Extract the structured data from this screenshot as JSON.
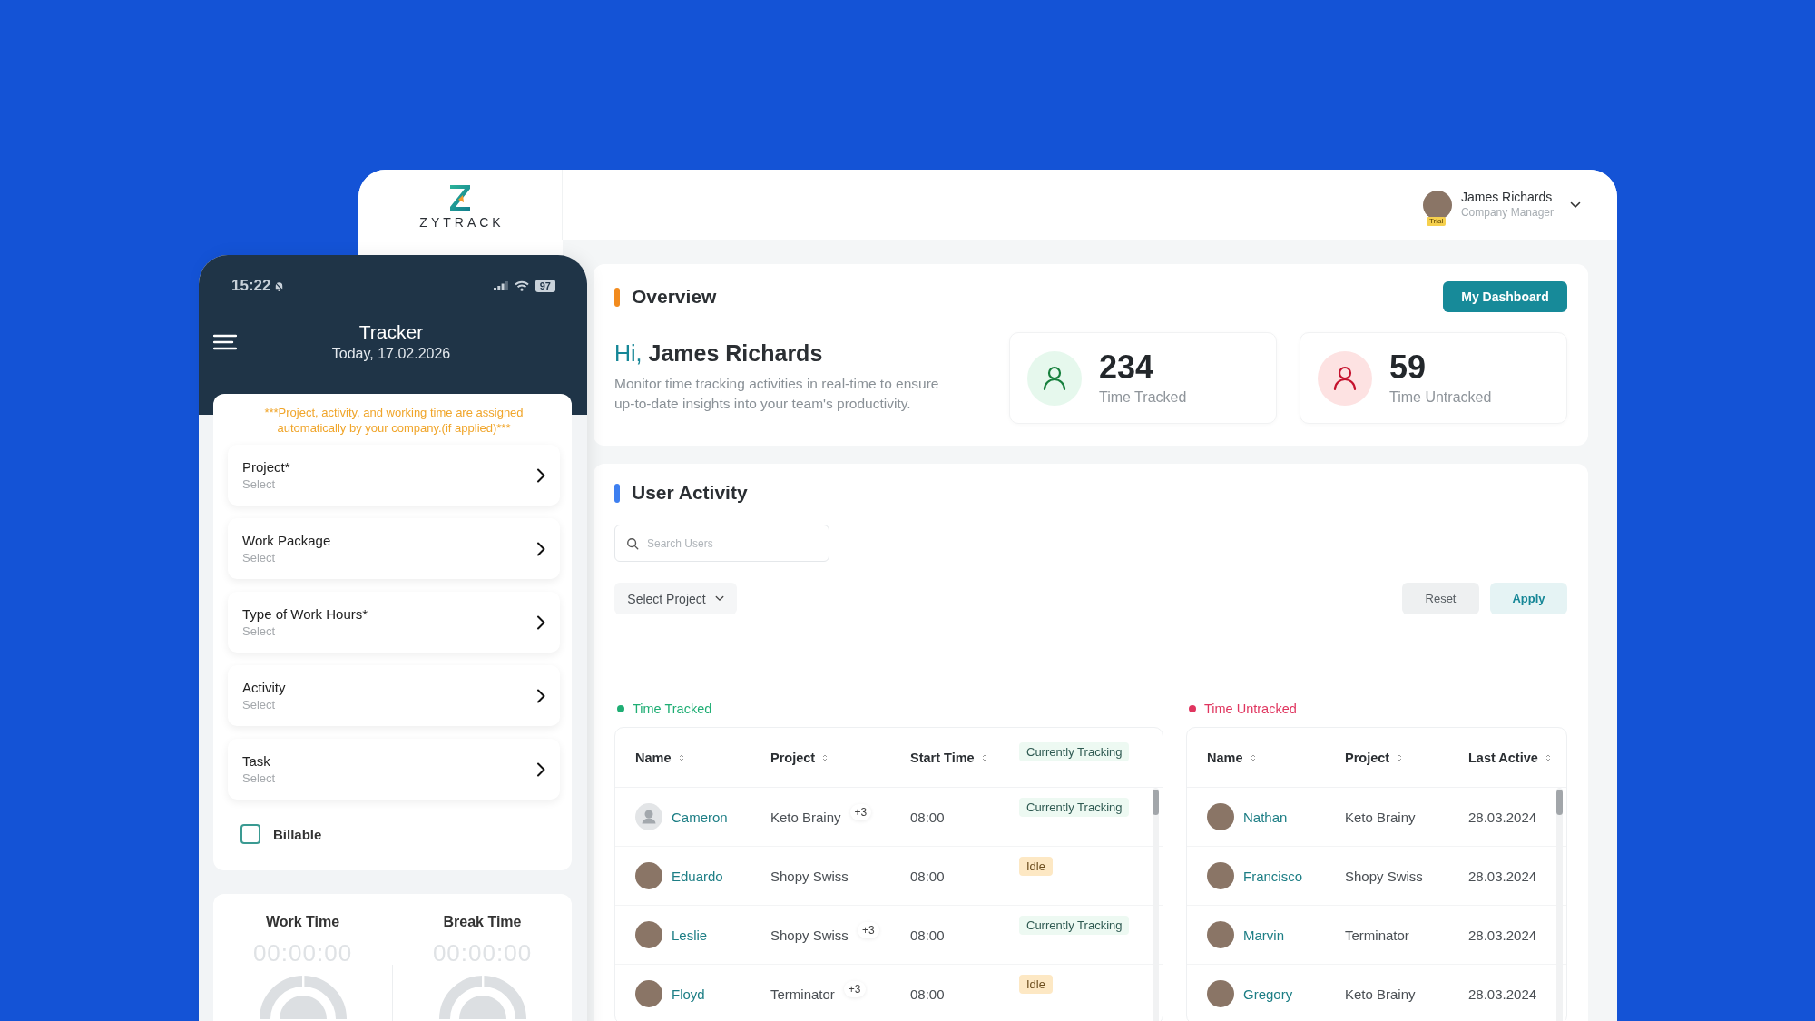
{
  "header": {
    "logo": "ZYTRACK",
    "user": {
      "name": "James Richards",
      "role": "Company Manager",
      "badge": "Trial",
      "photo": true
    }
  },
  "phone": {
    "status_bar": {
      "time": "15:22",
      "battery": "97"
    },
    "title": "Tracker",
    "date": "Today, 17.02.2026",
    "notice": "***Project, activity, and working time are assigned automatically by your company.(if applied)***",
    "fields": [
      {
        "label": "Project*",
        "placeholder": "Select"
      },
      {
        "label": "Work Package",
        "placeholder": "Select"
      },
      {
        "label": "Type of Work Hours*",
        "placeholder": "Select"
      },
      {
        "label": "Activity",
        "placeholder": "Select"
      },
      {
        "label": "Task",
        "placeholder": "Select"
      }
    ],
    "billable": {
      "label": "Billable",
      "checked": false
    },
    "timers": [
      {
        "label": "Work Time",
        "value": "00:00:00"
      },
      {
        "label": "Break Time",
        "value": "00:00:00"
      }
    ]
  },
  "overview": {
    "title": "Overview",
    "button": "My Dashboard",
    "greeting": "Hi,",
    "name": "James Richards",
    "description": "Monitor time tracking activities in real-time to ensure up-to-date insights into your team's productivity.",
    "stats": [
      {
        "value": "234",
        "label": "Time Tracked",
        "kind": "tracked"
      },
      {
        "value": "59",
        "label": "Time Untracked",
        "kind": "untracked"
      }
    ]
  },
  "user_activity": {
    "title": "User Activity",
    "search": {
      "placeholder": "Search Users"
    },
    "project_filter": {
      "label": "Select Project"
    },
    "buttons": [
      {
        "label": "Reset",
        "kind": "secondary"
      },
      {
        "label": "Apply",
        "kind": "primary"
      }
    ],
    "tables": [
      {
        "kind": "tracked",
        "title": "Time Tracked",
        "color": "#1fae74",
        "columns": [
          {
            "label": "Name",
            "sortable": true
          },
          {
            "label": "Project",
            "sortable": true
          },
          {
            "label": "Start Time",
            "sortable": true
          },
          {
            "badge": "Currently Tracking"
          }
        ],
        "rows": [
          {
            "name": "Cameron",
            "photo": false,
            "project": "Keto Brainy",
            "extra": "+3",
            "start_time": "08:00",
            "status": {
              "label": "Currently Tracking",
              "kind": "tracking"
            }
          },
          {
            "name": "Eduardo",
            "photo": true,
            "project": "Shopy Swiss",
            "start_time": "08:00",
            "status": {
              "label": "Idle",
              "kind": "idle"
            }
          },
          {
            "name": "Leslie",
            "photo": true,
            "project": "Shopy Swiss",
            "extra": "+3",
            "start_time": "08:00",
            "status": {
              "label": "Currently Tracking",
              "kind": "tracking"
            }
          },
          {
            "name": "Floyd",
            "photo": true,
            "project": "Terminator",
            "extra": "+3",
            "start_time": "08:00",
            "status": {
              "label": "Idle",
              "kind": "idle"
            }
          }
        ]
      },
      {
        "kind": "untracked",
        "title": "Time Untracked",
        "color": "#e0355f",
        "columns": [
          {
            "label": "Name",
            "sortable": true
          },
          {
            "label": "Project",
            "sortable": true
          },
          {
            "label": "Last Active",
            "sortable": true
          }
        ],
        "rows": [
          {
            "name": "Nathan",
            "photo": true,
            "project": "Keto Brainy",
            "last_active": "28.03.2024"
          },
          {
            "name": "Francisco",
            "photo": true,
            "project": "Shopy Swiss",
            "last_active": "28.03.2024"
          },
          {
            "name": "Marvin",
            "photo": true,
            "project": "Terminator",
            "last_active": "28.03.2024"
          },
          {
            "name": "Gregory",
            "photo": true,
            "project": "Keto Brainy",
            "last_active": "28.03.2024"
          }
        ]
      }
    ]
  }
}
